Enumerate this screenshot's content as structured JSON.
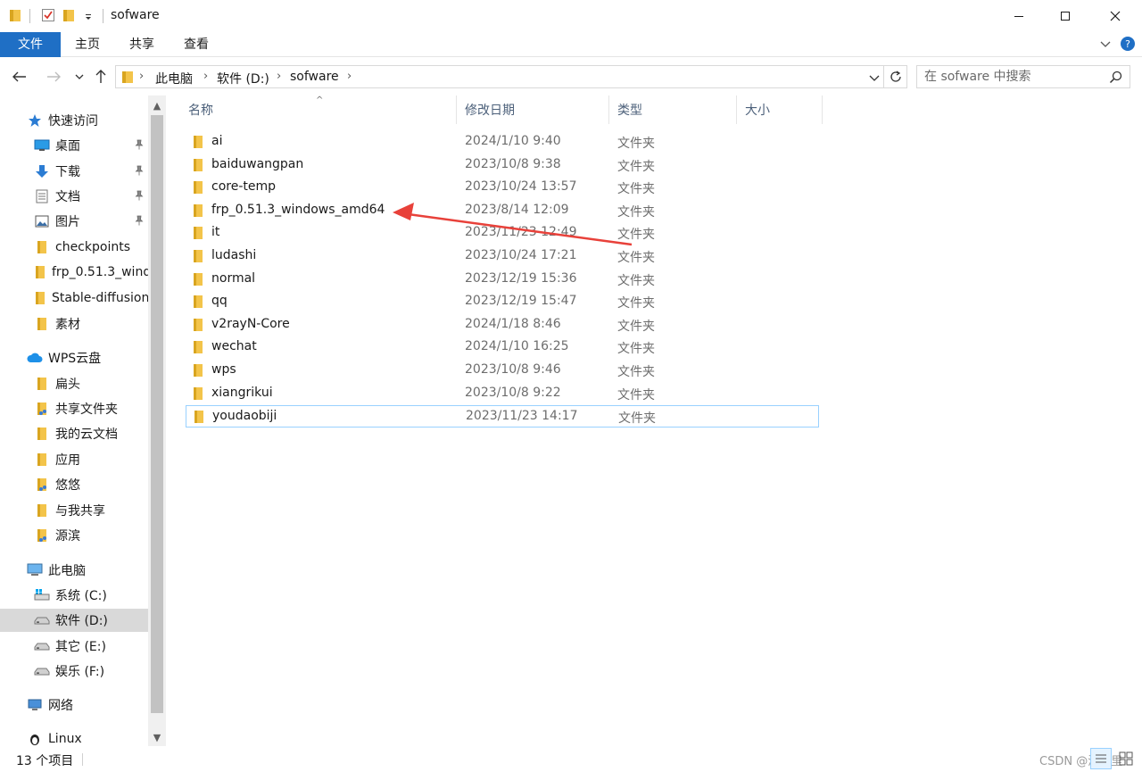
{
  "window": {
    "title": "sofware",
    "minimize_label": "minimize",
    "maximize_label": "maximize",
    "close_label": "close"
  },
  "ribbon": {
    "tabs": [
      "文件",
      "主页",
      "共享",
      "查看"
    ]
  },
  "address": {
    "crumbs": [
      "此电脑",
      "软件 (D:)",
      "sofware"
    ]
  },
  "search": {
    "placeholder": "在 sofware 中搜索"
  },
  "sidebar": {
    "items": [
      {
        "label": "快速访问",
        "icon": "star-icon"
      },
      {
        "label": "桌面",
        "icon": "desktop-icon",
        "pinned": true
      },
      {
        "label": "下载",
        "icon": "download-icon",
        "pinned": true
      },
      {
        "label": "文档",
        "icon": "document-icon",
        "pinned": true
      },
      {
        "label": "图片",
        "icon": "picture-icon",
        "pinned": true
      },
      {
        "label": "checkpoints",
        "icon": "folder-icon"
      },
      {
        "label": "frp_0.51.3_wind",
        "icon": "folder-icon"
      },
      {
        "label": "Stable-diffusion",
        "icon": "folder-icon"
      },
      {
        "label": "素材",
        "icon": "folder-icon"
      },
      {
        "label": "WPS云盘",
        "icon": "cloud-icon"
      },
      {
        "label": "扁头",
        "icon": "folder-icon"
      },
      {
        "label": "共享文件夹",
        "icon": "shared-folder-icon"
      },
      {
        "label": "我的云文档",
        "icon": "folder-icon"
      },
      {
        "label": "应用",
        "icon": "folder-icon"
      },
      {
        "label": "悠悠",
        "icon": "shared-folder-icon"
      },
      {
        "label": "与我共享",
        "icon": "folder-icon"
      },
      {
        "label": "源滨",
        "icon": "shared-folder-icon"
      },
      {
        "label": "此电脑",
        "icon": "computer-icon"
      },
      {
        "label": "系统 (C:)",
        "icon": "system-drive-icon"
      },
      {
        "label": "软件 (D:)",
        "icon": "drive-icon",
        "selected": true
      },
      {
        "label": "其它 (E:)",
        "icon": "drive-icon"
      },
      {
        "label": "娱乐 (F:)",
        "icon": "drive-icon"
      },
      {
        "label": "网络",
        "icon": "network-icon"
      },
      {
        "label": "Linux",
        "icon": "linux-icon"
      }
    ]
  },
  "columns": {
    "name": "名称",
    "date": "修改日期",
    "type": "类型",
    "size": "大小"
  },
  "files": [
    {
      "name": "ai",
      "date": "2024/1/10 9:40",
      "type": "文件夹"
    },
    {
      "name": "baiduwangpan",
      "date": "2023/10/8 9:38",
      "type": "文件夹"
    },
    {
      "name": "core-temp",
      "date": "2023/10/24 13:57",
      "type": "文件夹"
    },
    {
      "name": "frp_0.51.3_windows_amd64",
      "date": "2023/8/14 12:09",
      "type": "文件夹"
    },
    {
      "name": "it",
      "date": "2023/11/23 12:49",
      "type": "文件夹"
    },
    {
      "name": "ludashi",
      "date": "2023/10/24 17:21",
      "type": "文件夹"
    },
    {
      "name": "normal",
      "date": "2023/12/19 15:36",
      "type": "文件夹"
    },
    {
      "name": "qq",
      "date": "2023/12/19 15:47",
      "type": "文件夹"
    },
    {
      "name": "v2rayN-Core",
      "date": "2024/1/18 8:46",
      "type": "文件夹"
    },
    {
      "name": "wechat",
      "date": "2024/1/10 16:25",
      "type": "文件夹"
    },
    {
      "name": "wps",
      "date": "2023/10/8 9:46",
      "type": "文件夹"
    },
    {
      "name": "xiangrikui",
      "date": "2023/10/8 9:22",
      "type": "文件夹"
    },
    {
      "name": "youdaobiji",
      "date": "2023/11/23 14:17",
      "type": "文件夹"
    }
  ],
  "status": {
    "count": "13 个项目",
    "watermark": "CSDN @波子里"
  },
  "colors": {
    "file_tab": "#1f6fc5",
    "folder": "#f3c44a",
    "arrow": "#e8413a",
    "selected": "#d9d9d9"
  }
}
